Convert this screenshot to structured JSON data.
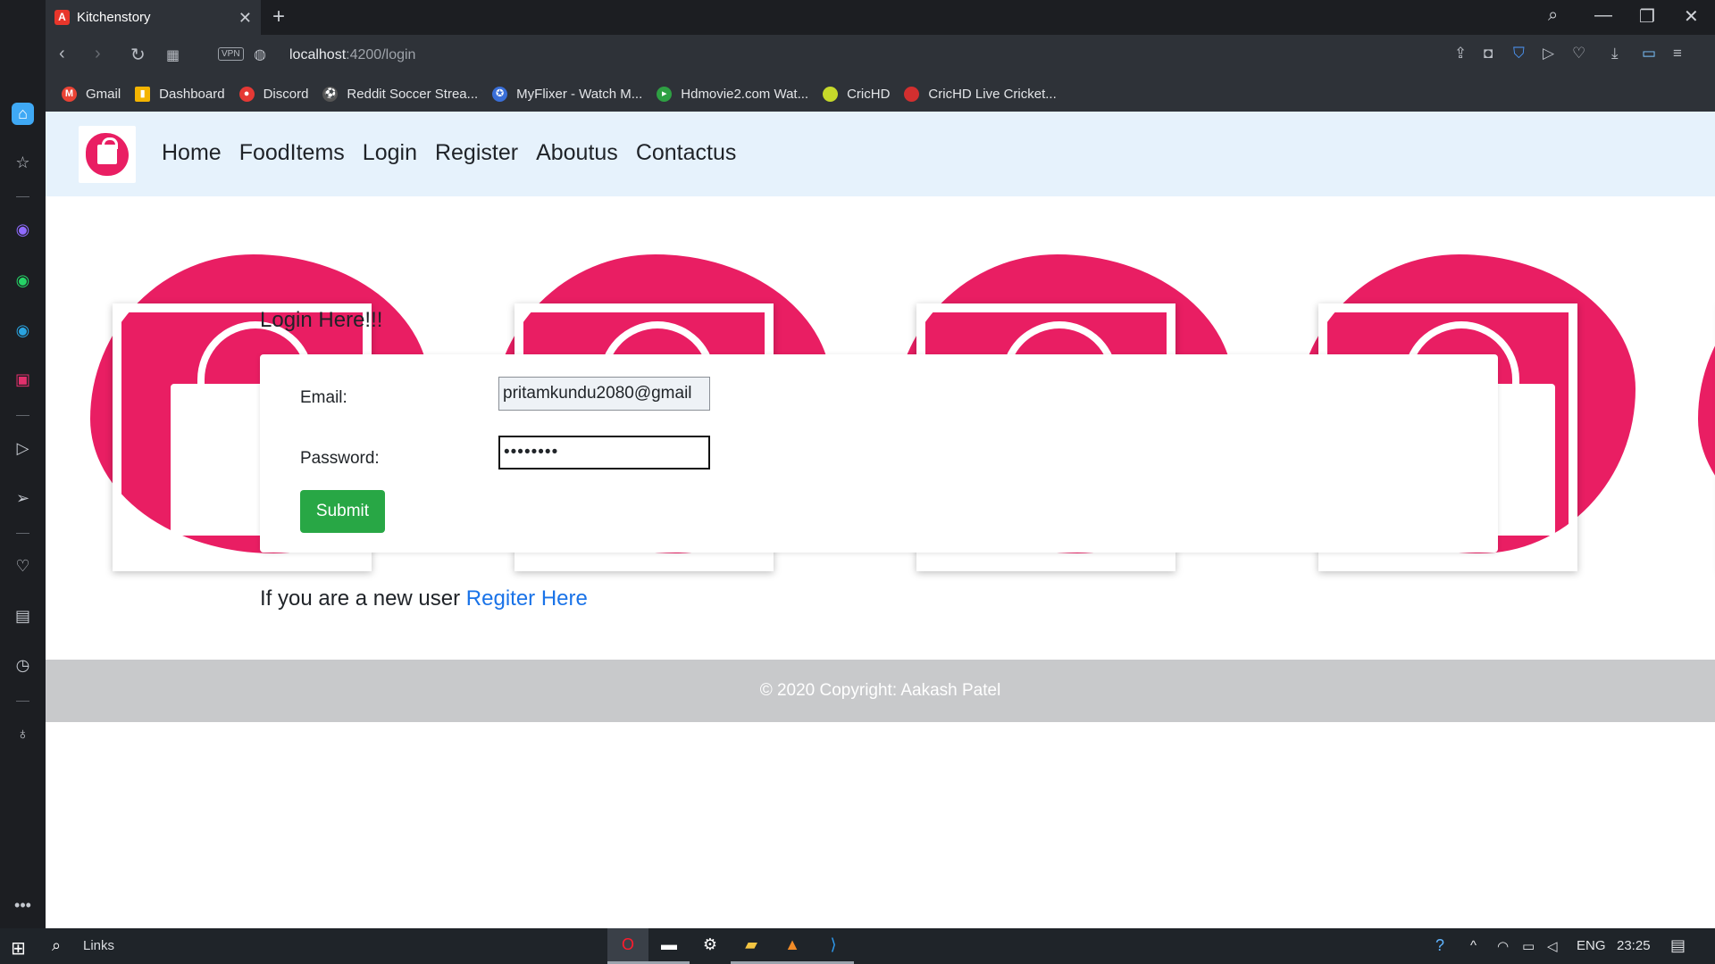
{
  "browser": {
    "tab_title": "Kitchenstory",
    "url_host": "localhost",
    "url_path": ":4200/login",
    "vpn_label": "VPN",
    "bookmarks": [
      {
        "label": "Gmail",
        "icon": "gmail-icon",
        "color": "#ea4335"
      },
      {
        "label": "Dashboard",
        "icon": "dashboard-icon",
        "color": "#f4b400"
      },
      {
        "label": "Discord",
        "icon": "discord-icon",
        "color": "#e53935"
      },
      {
        "label": "Reddit Soccer Strea...",
        "icon": "soccer-icon",
        "color": "#555555"
      },
      {
        "label": "MyFlixer - Watch M...",
        "icon": "myflixer-icon",
        "color": "#3a6fd8"
      },
      {
        "label": "Hdmovie2.com Wat...",
        "icon": "hdmovie-icon",
        "color": "#2ea043"
      },
      {
        "label": "CricHD",
        "icon": "crichd-icon",
        "color": "#c6d92a"
      },
      {
        "label": "CricHD Live Cricket...",
        "icon": "crichd-live-icon",
        "color": "#d32f2f"
      }
    ]
  },
  "site": {
    "nav": [
      "Home",
      "FoodItems",
      "Login",
      "Register",
      "Aboutus",
      "Contactus"
    ],
    "login_heading": "Login Here!!!",
    "email_label": "Email:",
    "email_value": "pritamkundu2080@gmail",
    "password_label": "Password:",
    "password_value": "••••••••",
    "submit_label": "Submit",
    "register_prefix": "If you are a new user ",
    "register_link": "Regiter Here",
    "footer": "© 2020 Copyright: Aakash Patel",
    "accent_color": "#e91e63",
    "button_color": "#28a745"
  },
  "taskbar": {
    "search_label": "Links",
    "lang": "ENG",
    "time": "23:25"
  }
}
